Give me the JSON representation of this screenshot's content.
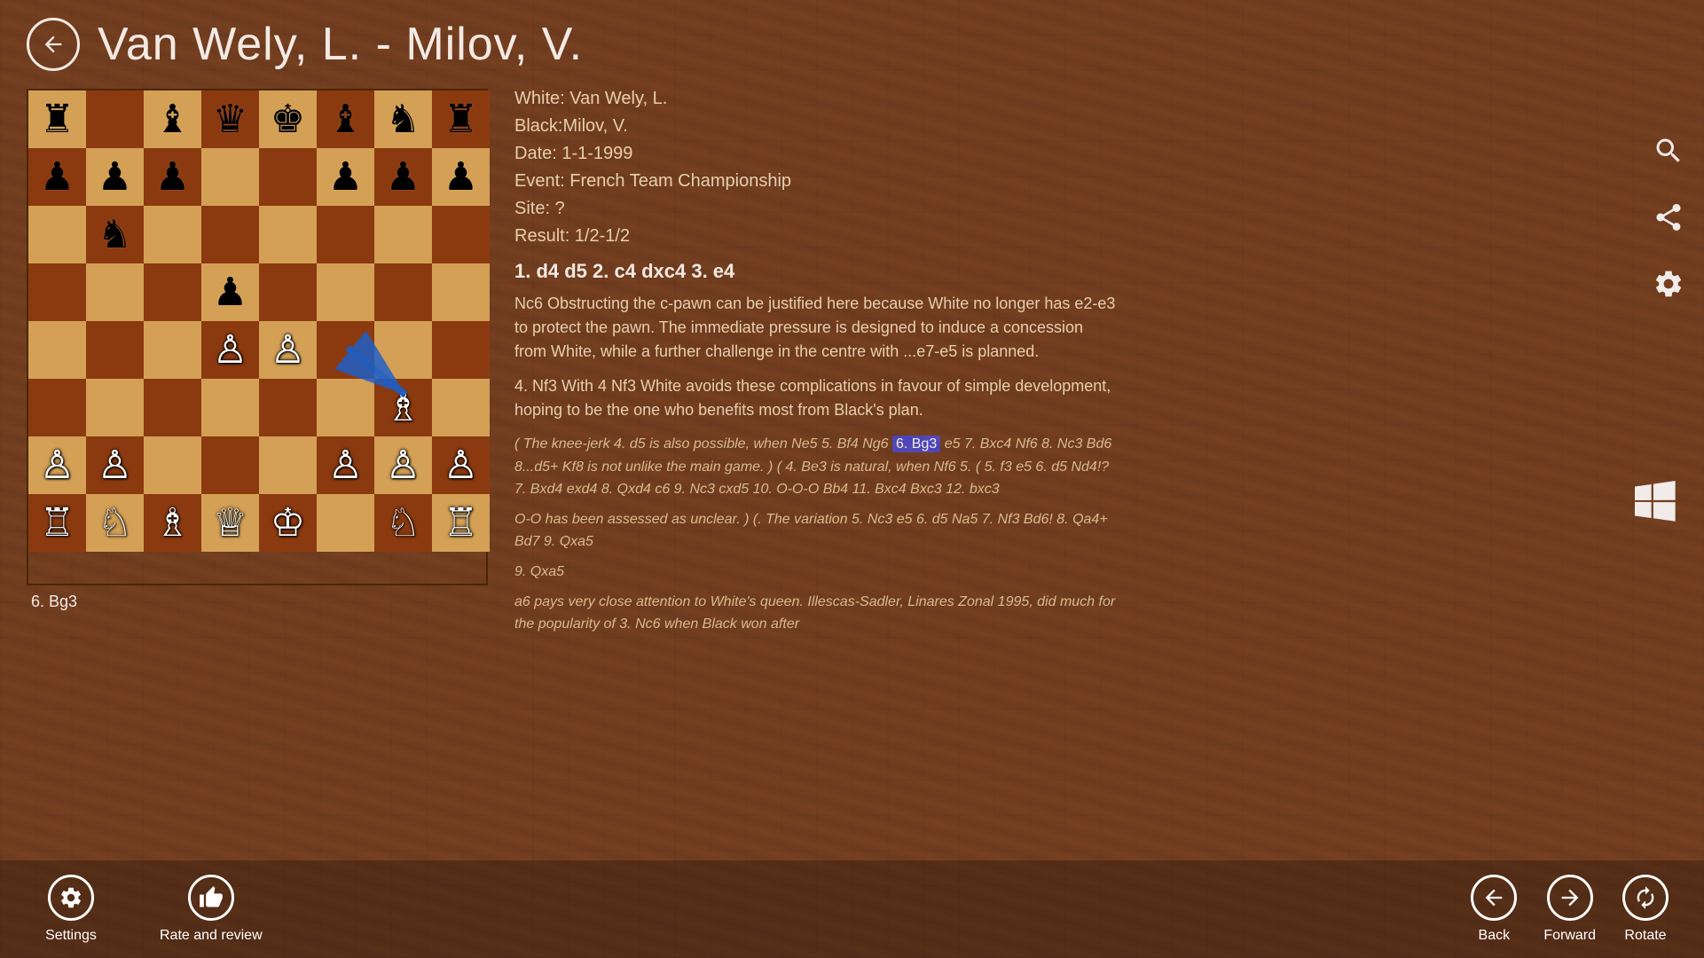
{
  "header": {
    "title": "Van Wely, L. - Milov, V.",
    "back_label": "back"
  },
  "game_info": {
    "white": "White: Van Wely, L.",
    "black": "Black:Milov, V.",
    "date": "Date: 1-1-1999",
    "event": "Event: French Team Championship",
    "site": "Site: ?",
    "result": "Result: 1/2-1/2"
  },
  "moves": {
    "opening": "1. d4  d5  2. c4  dxc4  3. e4",
    "annotation1": "Nc6 Obstructing the c-pawn can be justified here because White no longer has e2-e3 to protect the pawn. The immediate pressure is designed to induce a concession from White, while a further challenge in the centre with ...e7-e5 is planned.",
    "move4": "4. Nf3 With 4 Nf3 White avoids these complications in favour of simple development, hoping to be the one who benefits most from Black's plan.",
    "variation1": "( The knee-jerk  4. d5 is also possible, when  Ne5  5. Bf4  Ng6  6. Bg3  e5  7. Bxc4  Nf6  8. Nc3  Bd6  8...d5+ Kf8 is not unlike the main game.  )  (  4. Be3 is natural, when  Nf6  5.  (  5. f3  e5  6. d5  Nd4!?  7. Bxd4  exd4  8. Qxd4  c6  9. Nc3  cxd5  10. O-O-O  Bb4  11. Bxc4  Bxc3  12. bxc3",
    "variation2": "O-O has been assessed as unclear.  )  (. The variation  5. Nc3  e5  6. d5  Na5  7. Nf3  Bd6!  8. Qa4+  Bd7  9. Qxa5",
    "variation3": "a6 pays very close attention to White's queen. Illescas-Sadler, Linares Zonal 1995, did much for the popularity of 3. Nc6 when Black won after",
    "highlight_move": "6. Bg3"
  },
  "current_move_label": "6. Bg3",
  "board": {
    "description": "Chess position after 6. Bg3"
  },
  "bottom_bar": {
    "settings_label": "Settings",
    "rate_review_label": "Rate and review",
    "back_label": "Back",
    "forward_label": "Forward",
    "rotate_label": "Rotate"
  },
  "right_icons": {
    "search": "search",
    "share": "share",
    "windows": "windows",
    "gear": "gear"
  }
}
